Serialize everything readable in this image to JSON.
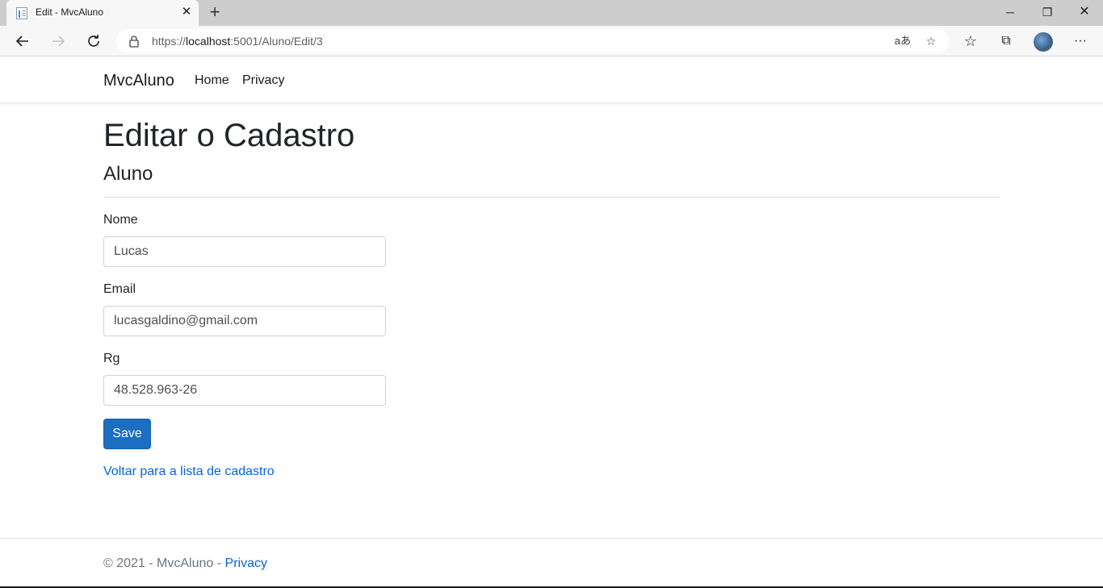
{
  "browser": {
    "tab_title": "Edit - MvcAluno",
    "url_prefix": "https://",
    "url_host": "localhost",
    "url_rest": ":5001/Aluno/Edit/3",
    "icons": [
      "back-arrow",
      "forward-arrow",
      "refresh",
      "lock",
      "read-aloud",
      "add-favorite",
      "favorites",
      "collections",
      "profile-avatar",
      "more-menu"
    ]
  },
  "navbar": {
    "brand": "MvcAluno",
    "links": [
      "Home",
      "Privacy"
    ]
  },
  "page": {
    "title": "Editar o Cadastro",
    "subtitle": "Aluno"
  },
  "form": {
    "nome_label": "Nome",
    "nome_value": "Lucas",
    "email_label": "Email",
    "email_value": "lucasgaldino@gmail.com",
    "rg_label": "Rg",
    "rg_value": "48.528.963-26",
    "save_label": "Save",
    "back_link": "Voltar para a lista de cadastro"
  },
  "footer": {
    "text": "© 2021 - MvcAluno - ",
    "privacy_link": "Privacy"
  },
  "colors": {
    "primary_button": "#1b6ec2",
    "link": "#0366d6"
  }
}
